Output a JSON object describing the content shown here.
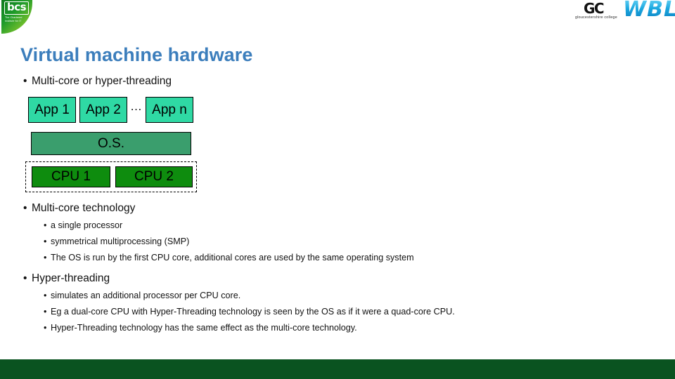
{
  "header": {
    "bcs_logo": {
      "word": "bcs",
      "tagline": "The Chartered Institute for IT"
    },
    "gc_logo": {
      "mark": "GC",
      "name": "gloucestershire college"
    },
    "wbl_logo": {
      "text": "WBL"
    }
  },
  "title": "Virtual machine hardware",
  "bullets": {
    "intro": "Multi-core or hyper-threading",
    "multicore_heading": "Multi-core technology",
    "multicore_items": [
      "a single processor",
      "symmetrical multiprocessing (SMP)",
      "The OS is run by the first CPU core, additional cores are used by the same operating system"
    ],
    "hyperthreading_heading": "Hyper-threading",
    "hyperthreading_items": [
      "simulates an additional processor per CPU core.",
      "Eg  a dual-core CPU with Hyper-Threading technology is seen by the OS as if it were a quad-core CPU.",
      "Hyper-Threading technology has the same effect as the multi-core technology."
    ],
    "bullet_glyph": "•"
  },
  "diagram": {
    "apps": [
      "App 1",
      "App 2",
      "App n"
    ],
    "ellipsis": "…",
    "os": "O.S.",
    "cpus": [
      "CPU 1",
      "CPU 2"
    ],
    "colors": {
      "app_fill": "#2fd9a4",
      "os_fill": "#3a9e6d",
      "cpu_fill": "#0e8c0e",
      "outline": "#000000"
    }
  },
  "theme": {
    "title_color": "#3c7ebc",
    "footer_color": "#0a5320",
    "background": "#ffffff"
  }
}
